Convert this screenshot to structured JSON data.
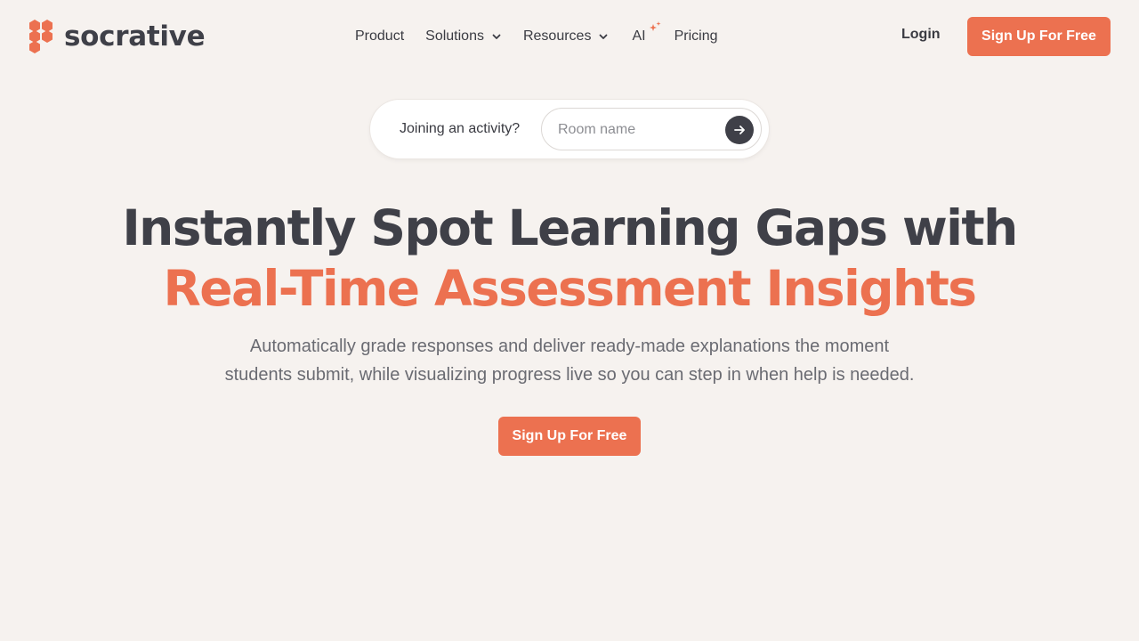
{
  "brand": {
    "name": "socrative",
    "accent": "#ec7150",
    "dark": "#3f4048"
  },
  "nav": {
    "product": "Product",
    "solutions": "Solutions",
    "resources": "Resources",
    "ai": "AI",
    "pricing": "Pricing",
    "login": "Login",
    "signup": "Sign Up For Free"
  },
  "join": {
    "label": "Joining an activity?",
    "placeholder": "Room name",
    "submit_icon": "arrow-right-icon"
  },
  "hero": {
    "title_line1": "Instantly Spot Learning Gaps with",
    "title_line2": "Real-Time Assessment Insights",
    "subtitle_line1": "Automatically grade responses and deliver ready-made explanations the moment",
    "subtitle_line2": "students submit, while visualizing progress live so you can step in when help is needed.",
    "cta": "Sign Up For Free"
  }
}
